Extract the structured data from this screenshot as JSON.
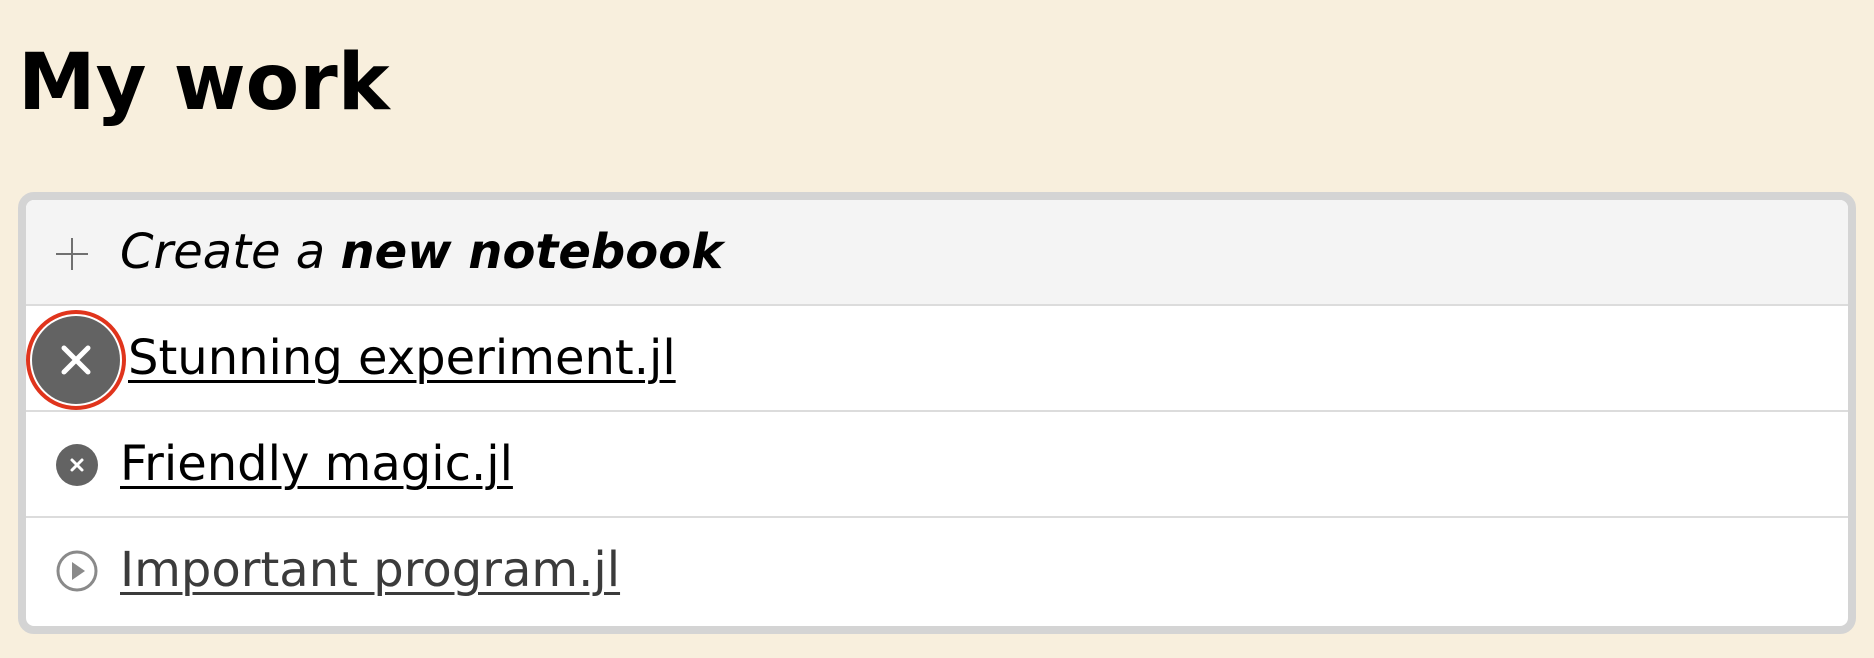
{
  "page": {
    "title": "My work"
  },
  "notebooks": {
    "new": {
      "prefix": "Create a ",
      "bold": "new notebook",
      "icon": "plus-icon"
    },
    "items": [
      {
        "name": "Stunning experiment.jl",
        "status": "running",
        "icon": "close-circle-icon",
        "hovered": true
      },
      {
        "name": "Friendly magic.jl",
        "status": "running",
        "icon": "close-circle-icon"
      },
      {
        "name": "Important program.jl",
        "status": "stopped",
        "icon": "play-circle-icon"
      }
    ]
  },
  "colors": {
    "background": "#f8efdd",
    "list_border": "#d4d4d4",
    "stop_button": "#636363",
    "highlight_ring": "#e0341c"
  }
}
